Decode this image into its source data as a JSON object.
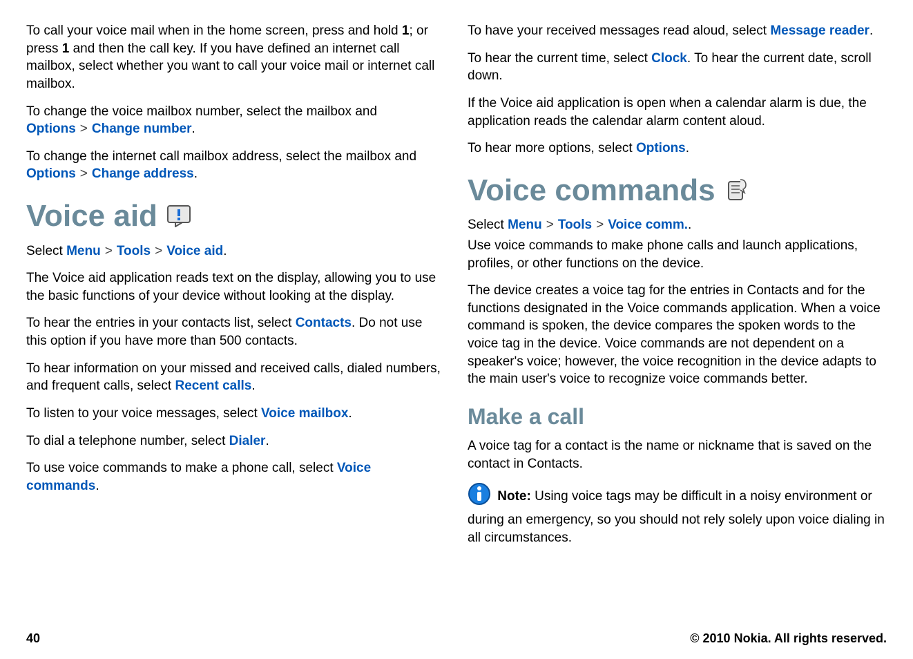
{
  "left": {
    "p1_a": "To call your voice mail when in the home screen, press and hold ",
    "p1_b": "1",
    "p1_c": "; or press ",
    "p1_d": "1",
    "p1_e": " and then the call key. If you have defined an internet call mailbox, select whether you want to call your voice mail or internet call mailbox.",
    "p2_a": "To change the voice mailbox number, select the mailbox and ",
    "p2_opt": "Options",
    "p2_b": "Change number",
    "p2_c": ".",
    "p3_a": "To change the internet call mailbox address, select the mailbox and ",
    "p3_opt": "Options",
    "p3_b": "Change address",
    "p3_c": ".",
    "h_voiceaid": "Voice aid",
    "p4_a": "Select ",
    "p4_m": "Menu",
    "p4_t": "Tools",
    "p4_v": "Voice aid",
    "p4_b": ".",
    "p5": "The Voice aid application reads text on the display, allowing you to use the basic functions of your device without looking at the display.",
    "p6_a": "To hear the entries in your contacts list, select ",
    "p6_k": "Contacts",
    "p6_b": ". Do not use this option if you have more than 500 contacts.",
    "p7_a": "To hear information on your missed and received calls, dialed numbers, and frequent calls, select ",
    "p7_k": "Recent calls",
    "p7_b": ".",
    "p8_a": "To listen to your voice messages, select ",
    "p8_k": "Voice mailbox",
    "p8_b": ".",
    "p9_a": "To dial a telephone number, select ",
    "p9_k": "Dialer",
    "p9_b": ".",
    "p10_a": "To use voice commands to make a phone call, select ",
    "p10_k": "Voice commands",
    "p10_b": "."
  },
  "right": {
    "p1_a": "To have your received messages read aloud, select ",
    "p1_k": "Message reader",
    "p1_b": ".",
    "p2_a": "To hear the current time, select ",
    "p2_k": "Clock",
    "p2_b": ". To hear the current date, scroll down.",
    "p3": "If the Voice aid application is open when a calendar alarm is due, the application reads the calendar alarm content aloud.",
    "p4_a": "To hear more options, select ",
    "p4_k": "Options",
    "p4_b": ".",
    "h_vcmd": "Voice commands",
    "p5_a": "Select ",
    "p5_m": "Menu",
    "p5_t": "Tools",
    "p5_v": "Voice comm.",
    "p5_b": ".",
    "p6": "Use voice commands to make phone calls and launch applications, profiles, or other functions on the device.",
    "p7": "The device creates a voice tag for the entries in Contacts and for the functions designated in the Voice commands application. When a voice command is spoken, the device compares the spoken words to the voice tag in the device. Voice commands are not dependent on a speaker's voice; however, the voice recognition in the device adapts to the main user's voice to recognize voice commands better.",
    "h_makecall": "Make a call",
    "p8": "A voice tag for a contact is the name or nickname that is saved on the contact in Contacts.",
    "note_label": "Note:  ",
    "note_body": "Using voice tags may be difficult in a noisy environment or during an emergency, so you should not rely solely upon voice dialing in all circumstances."
  },
  "footer": {
    "page": "40",
    "copyright": "© 2010 Nokia. All rights reserved."
  },
  "gt": ">"
}
